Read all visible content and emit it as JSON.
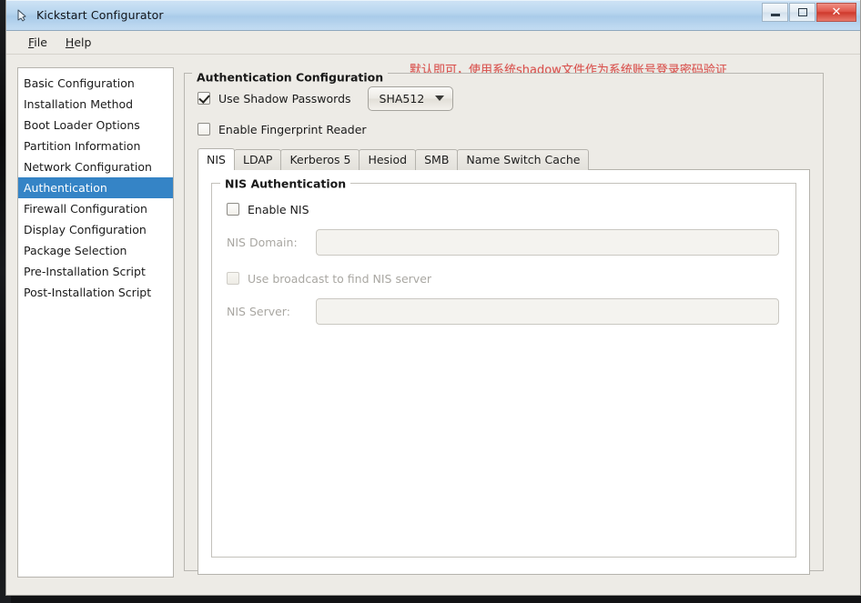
{
  "window": {
    "title": "Kickstart Configurator",
    "icon": "app-icon",
    "buttons": {
      "minimize": "minimize",
      "maximize": "maximize",
      "close": "✕"
    }
  },
  "menubar": {
    "items": [
      {
        "label": "File",
        "mnemonic": "F",
        "rest": "ile"
      },
      {
        "label": "Help",
        "mnemonic": "H",
        "rest": "elp"
      }
    ]
  },
  "sidebar": {
    "items": [
      {
        "label": "Basic Configuration",
        "selected": false
      },
      {
        "label": "Installation Method",
        "selected": false
      },
      {
        "label": "Boot Loader Options",
        "selected": false
      },
      {
        "label": "Partition Information",
        "selected": false
      },
      {
        "label": "Network Configuration",
        "selected": false
      },
      {
        "label": "Authentication",
        "selected": true
      },
      {
        "label": "Firewall Configuration",
        "selected": false
      },
      {
        "label": "Display Configuration",
        "selected": false
      },
      {
        "label": "Package Selection",
        "selected": false
      },
      {
        "label": "Pre-Installation Script",
        "selected": false
      },
      {
        "label": "Post-Installation Script",
        "selected": false
      }
    ],
    "selected_color": "#3584c6"
  },
  "annotation": {
    "text": "默认即可，使用系统shadow文件作为系统账号登录密码验证",
    "color": "#d9534f"
  },
  "auth": {
    "group_title": "Authentication Configuration",
    "use_shadow": {
      "label": "Use Shadow Passwords",
      "checked": true
    },
    "hash_select": {
      "value": "SHA512",
      "caret": "chevron-down-icon"
    },
    "fingerprint": {
      "label": "Enable Fingerprint Reader",
      "checked": false
    }
  },
  "tabs": [
    {
      "label": "NIS",
      "active": true
    },
    {
      "label": "LDAP",
      "active": false
    },
    {
      "label": "Kerberos 5",
      "active": false
    },
    {
      "label": "Hesiod",
      "active": false
    },
    {
      "label": "SMB",
      "active": false
    },
    {
      "label": "Name Switch Cache",
      "active": false
    }
  ],
  "nis": {
    "group_title": "NIS Authentication",
    "enable": {
      "label": "Enable NIS",
      "checked": false,
      "disabled": false
    },
    "domain": {
      "label": "NIS Domain:",
      "value": "",
      "disabled": true
    },
    "broadcast": {
      "label": "Use broadcast to find NIS server",
      "checked": false,
      "disabled": true
    },
    "server": {
      "label": "NIS Server:",
      "value": "",
      "disabled": true
    }
  }
}
